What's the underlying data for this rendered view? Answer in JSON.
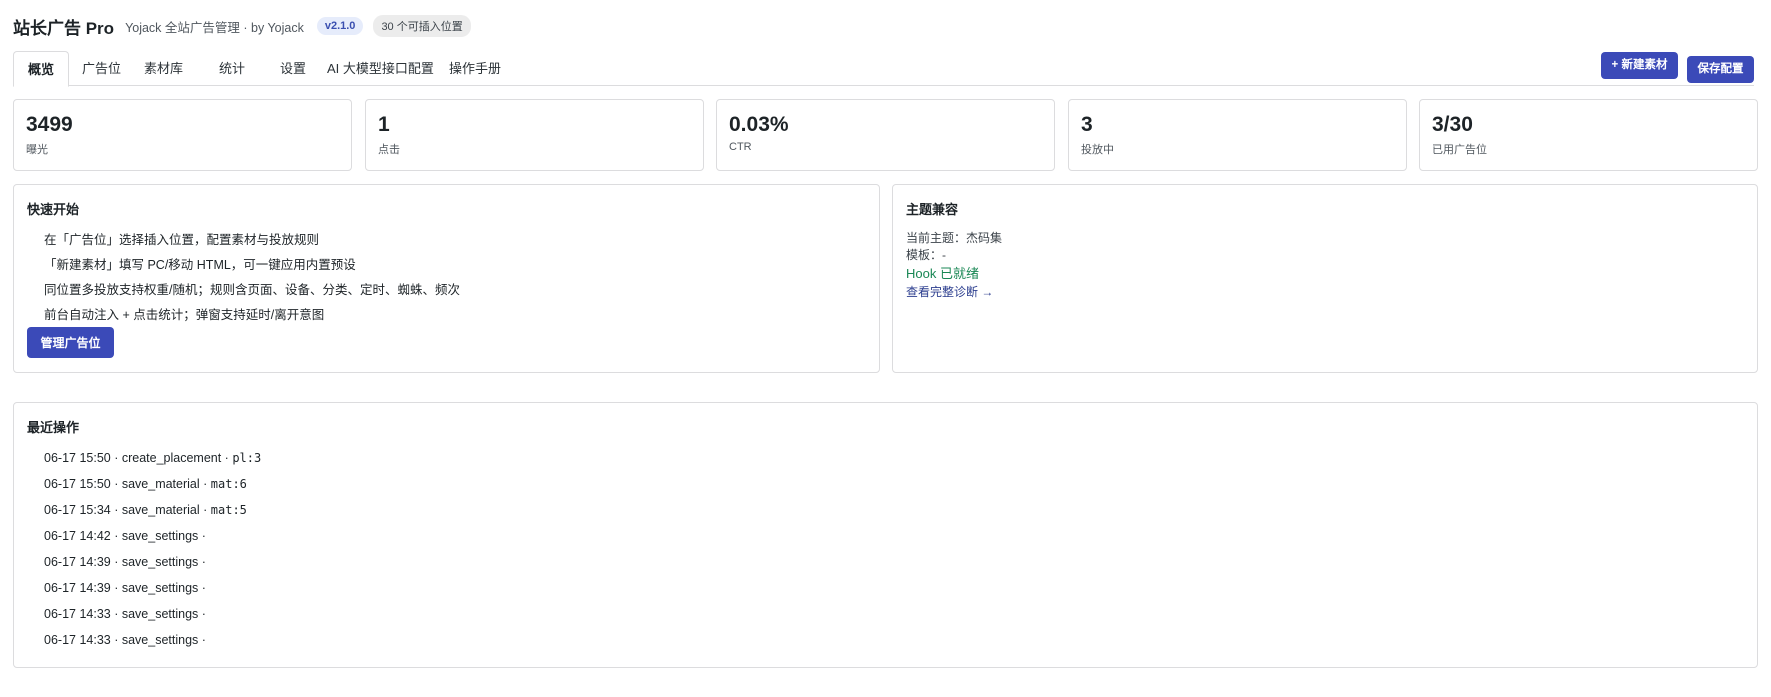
{
  "header": {
    "title": "站长广告 Pro",
    "subtitle": "Yojack 全站广告管理 · by Yojack",
    "version_badge": "v2.1.0",
    "positions_badge": "30 个可插入位置"
  },
  "tabs": [
    {
      "label": "概览",
      "active": true
    },
    {
      "label": "广告位",
      "active": false
    },
    {
      "label": "素材库",
      "active": false
    },
    {
      "label": "统计",
      "active": false
    },
    {
      "label": "设置",
      "active": false
    },
    {
      "label": "AI 大模型接口配置",
      "active": false
    },
    {
      "label": "操作手册",
      "active": false
    }
  ],
  "actions": {
    "new_material": "+ 新建素材",
    "save_config": "保存配置"
  },
  "stats": [
    {
      "value": "3499",
      "label": "曝光"
    },
    {
      "value": "1",
      "label": "点击"
    },
    {
      "value": "0.03%",
      "label": "CTR"
    },
    {
      "value": "3",
      "label": "投放中"
    },
    {
      "value": "3/30",
      "label": "已用广告位"
    }
  ],
  "quick_start": {
    "title": "快速开始",
    "items": [
      "在「广告位」选择插入位置，配置素材与投放规则",
      "「新建素材」填写 PC/移动 HTML，可一键应用内置预设",
      "同位置多投放支持权重/随机；规则含页面、设备、分类、定时、蜘蛛、频次",
      "前台自动注入 + 点击统计；弹窗支持延时/离开意图"
    ],
    "button": "管理广告位"
  },
  "theme": {
    "title": "主题兼容",
    "current_theme": "当前主题：杰码集",
    "template": "模板：-",
    "hook_status": "Hook 已就绪",
    "diagnose_link": "查看完整诊断 →"
  },
  "recent": {
    "title": "最近操作",
    "items": [
      {
        "text": "06-17 15:50 · create_placement · ",
        "ref": "pl:3"
      },
      {
        "text": "06-17 15:50 · save_material · ",
        "ref": "mat:6"
      },
      {
        "text": "06-17 15:34 · save_material · ",
        "ref": "mat:5"
      },
      {
        "text": "06-17 14:42 · save_settings · ",
        "ref": ""
      },
      {
        "text": "06-17 14:39 · save_settings · ",
        "ref": ""
      },
      {
        "text": "06-17 14:39 · save_settings · ",
        "ref": ""
      },
      {
        "text": "06-17 14:33 · save_settings · ",
        "ref": ""
      },
      {
        "text": "06-17 14:33 · save_settings · ",
        "ref": ""
      }
    ]
  },
  "colors": {
    "accent": "#3b4ab8",
    "success": "#198754",
    "border": "#dcdcde"
  }
}
